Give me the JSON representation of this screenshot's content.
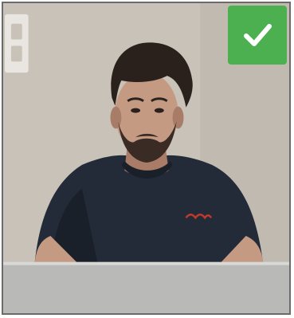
{
  "colors": {
    "wall": "#c9c2b8",
    "wall_shadow": "#b3aca2",
    "skin": "#c49a83",
    "skin_shadow": "#a87c66",
    "hair": "#2b211c",
    "beard": "#3a2c25",
    "shirt": "#232b38",
    "shirt_shadow": "#1a2029",
    "shirt_logo": "#c0392b",
    "laptop": "#b9b9b7",
    "laptop_edge": "#d8d8d6",
    "switch_plate": "#e9e6e1",
    "frame_border": "#6b6b6b",
    "badge": "#4caf50",
    "check": "#ffffff"
  },
  "badge": {
    "icon": "checkmark-icon",
    "state": "verified"
  },
  "icons": {
    "wall_switch": "light-switch-icon"
  }
}
